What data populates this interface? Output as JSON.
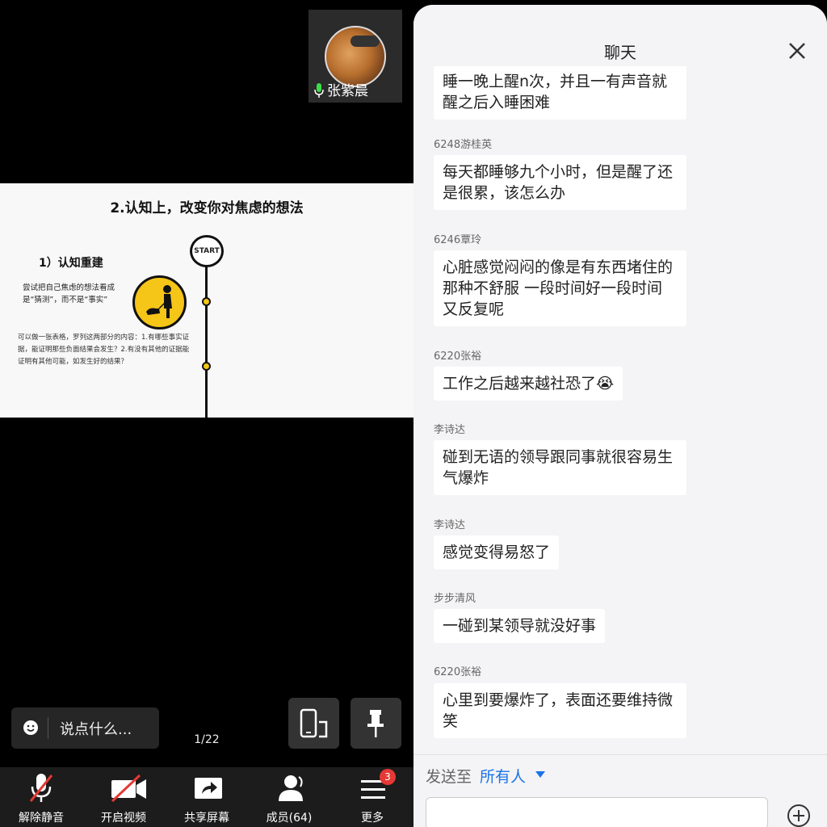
{
  "participant": {
    "name": "张紫晨",
    "avatar_icon": "profile-photo"
  },
  "slide": {
    "title": "2.认知上，改变你对焦虑的想法",
    "subtitle": "1）认知重建",
    "description": "尝试把自己焦虑的想法看成是“猜测”，而不是“事实”",
    "body": "可以做一张表格，罗列这两部分的内容：1.有哪些事实证据，能证明那些负面结果会发生？2.有没有其他的证据能证明有其他可能，如发生好的结果？",
    "timeline_start": "START",
    "page": "1/22"
  },
  "chat_input": {
    "placeholder": "说点什么..."
  },
  "toolbar": {
    "unmute": "解除静音",
    "video": "开启视频",
    "share": "共享屏幕",
    "members": "成员(64)",
    "more": "更多",
    "more_badge": "3"
  },
  "chat": {
    "title": "聊天",
    "messages": [
      {
        "sender": "",
        "text": "睡一晚上醒n次，并且一有声音就醒之后入睡困难"
      },
      {
        "sender": "6248游桂英",
        "text": "每天都睡够九个小时，但是醒了还是很累，该怎么办"
      },
      {
        "sender": "6246覃玲",
        "text": "心脏感觉闷闷的像是有东西堵住的那种不舒服  一段时间好一段时间又反复呢"
      },
      {
        "sender": "6220张裕",
        "text": "工作之后越来越社恐了😭"
      },
      {
        "sender": "李诗达",
        "text": "碰到无语的领导跟同事就很容易生气爆炸"
      },
      {
        "sender": "李诗达",
        "text": "感觉变得易怒了"
      },
      {
        "sender": "步步清风",
        "text": "一碰到某领导就没好事"
      },
      {
        "sender": "6220张裕",
        "text": "心里到要爆炸了，表面还要维持微笑"
      }
    ],
    "send_to_label": "发送至",
    "send_to_target": "所有人"
  }
}
